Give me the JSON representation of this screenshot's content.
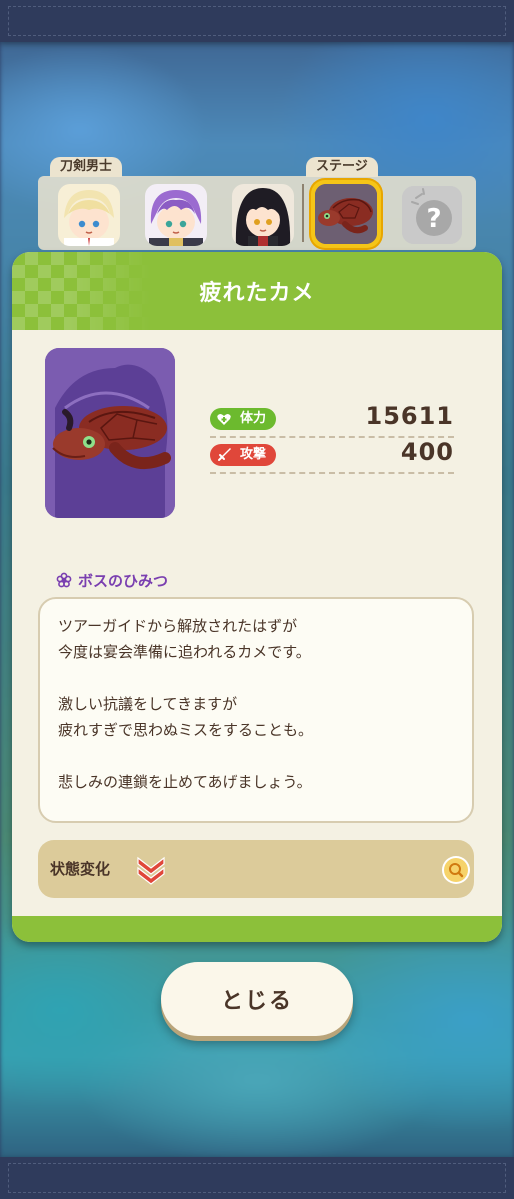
{
  "tabs": {
    "toukendanshi_label": "刀剣男士",
    "stage_label": "ステージ"
  },
  "icons": {
    "characters": [
      "character-blonde-icon",
      "character-purple-hair-icon",
      "character-black-hair-icon"
    ],
    "stage": "turtle-stage-icon",
    "locked": "question-mark-locked-icon"
  },
  "panel": {
    "title": "疲れたカメ",
    "stats": {
      "hp_label": "体力",
      "hp_value": "15611",
      "atk_label": "攻撃",
      "atk_value": "400"
    },
    "secret": {
      "title": "ボスのひみつ",
      "lines": [
        "ツアーガイドから解放されたはずが",
        "今度は宴会準備に追われるカメです。",
        "",
        "激しい抗議をしてきますが",
        "疲れすぎで思わぬミスをすることも。",
        "",
        "悲しみの連鎖を止めてあげましょう。"
      ]
    },
    "status": {
      "label": "状態変化"
    }
  },
  "close_button": "とじる",
  "colors": {
    "header_green": "#8cc03a",
    "hp_green": "#6cba2e",
    "attack_red": "#e0473a",
    "secret_purple": "#7a3fb0",
    "stage_highlight": "#f5c518"
  }
}
